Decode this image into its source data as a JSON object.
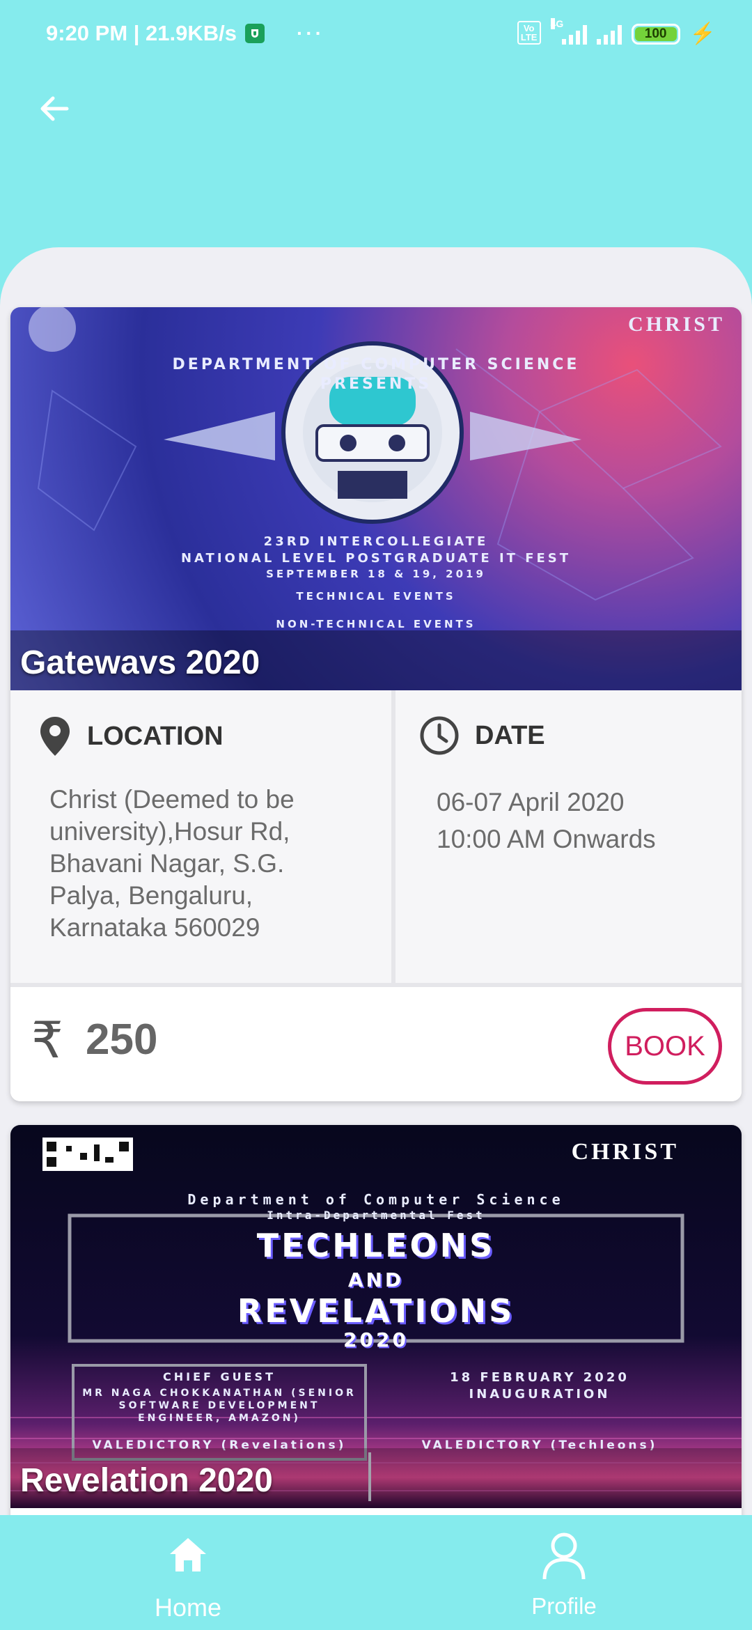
{
  "status_bar": {
    "time_speed": "9:20 PM | 21.9KB/s",
    "dots": "···",
    "volte": "Vo LTE",
    "network": "4G",
    "battery": "100"
  },
  "events": [
    {
      "title": "Gatewavs 2020",
      "poster": {
        "brand": "CHRIST",
        "line1": "DEPARTMENT OF COMPUTER SCIENCE",
        "line2": "PRESENTS",
        "line3": "23RD INTERCOLLEGIATE",
        "line4": "NATIONAL LEVEL POSTGRADUATE IT FEST",
        "line5": "SEPTEMBER 18 & 19, 2019",
        "line6": "TECHNICAL EVENTS",
        "line7": "NON-TECHNICAL EVENTS"
      },
      "location_label": "LOCATION",
      "location": "Christ (Deemed to be university),Hosur Rd, Bhavani Nagar, S.G. Palya, Bengaluru, Karnataka 560029",
      "date_label": "DATE",
      "date_line1": "06-07 April 2020",
      "date_line2": "10:00 AM Onwards",
      "currency": "₹",
      "price": "250",
      "book_label": "BOOK"
    },
    {
      "title": "Revelation 2020",
      "poster": {
        "brand": "CHRIST",
        "line1": "Department of Computer Science",
        "line2": "Intra-Departmental Fest",
        "line3": "TECHLEONS",
        "line4": "AND",
        "line5": "REVELATIONS",
        "line6": "2020",
        "line7": "CHIEF GUEST",
        "line8": "MR NAGA CHOKKANATHAN (SENIOR SOFTWARE DEVELOPMENT ENGINEER, AMAZON)",
        "line9": "18 FEBRUARY 2020",
        "line10": "INAUGURATION",
        "line11": "VALEDICTORY (Revelations)",
        "line12": "VALEDICTORY (Techleons)"
      }
    }
  ],
  "nav": {
    "home_label": "Home",
    "profile_label": "Profile"
  },
  "colors": {
    "background": "#85ebed",
    "accent": "#d01e5e"
  }
}
